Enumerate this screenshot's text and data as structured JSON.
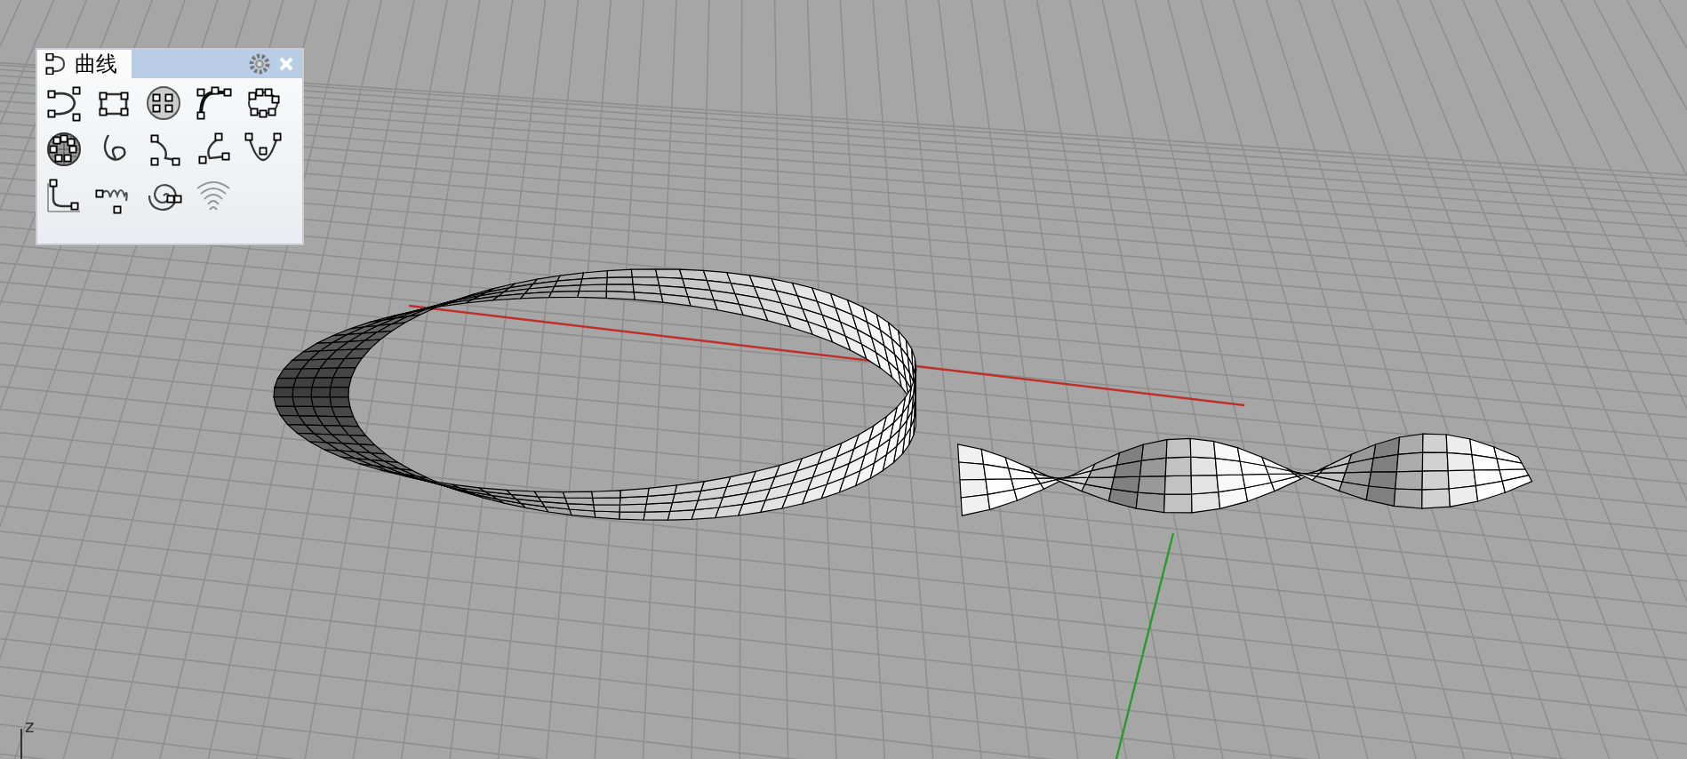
{
  "toolbar": {
    "tab": {
      "label": "曲线",
      "selected": true
    },
    "tools": [
      {
        "kind": "arc"
      },
      {
        "kind": "rectangle"
      },
      {
        "kind": "circle"
      },
      {
        "kind": "curve"
      },
      {
        "kind": "polygon"
      },
      {
        "kind": "sphere"
      },
      {
        "kind": "loop"
      },
      {
        "kind": "hook"
      },
      {
        "kind": "bend"
      },
      {
        "kind": "parabola"
      },
      {
        "kind": "corner"
      },
      {
        "kind": "helix"
      },
      {
        "kind": "spiral"
      },
      {
        "kind": "arcs"
      }
    ]
  },
  "viewport": {
    "axis_label": "z"
  }
}
